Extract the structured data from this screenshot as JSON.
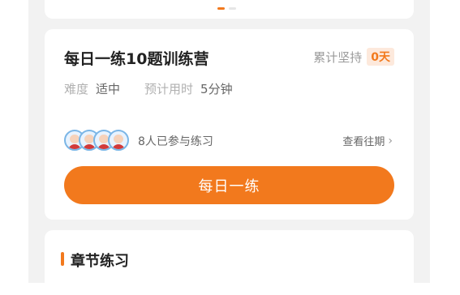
{
  "carousel": {
    "page_count": 2,
    "active_index": 0
  },
  "daily_practice": {
    "title": "每日一练10题训练营",
    "streak_label": "累计坚持",
    "streak_value": "0天",
    "difficulty_label": "难度",
    "difficulty_value": "适中",
    "duration_label": "预计用时",
    "duration_value": "5分钟",
    "participants_text": "8人已参与练习",
    "history_link": "查看往期",
    "button_label": "每日一练"
  },
  "chapter_section": {
    "title": "章节练习"
  },
  "colors": {
    "accent": "#f2791d",
    "badge_bg": "#fde9dc",
    "page_bg": "#f2f2f2"
  }
}
